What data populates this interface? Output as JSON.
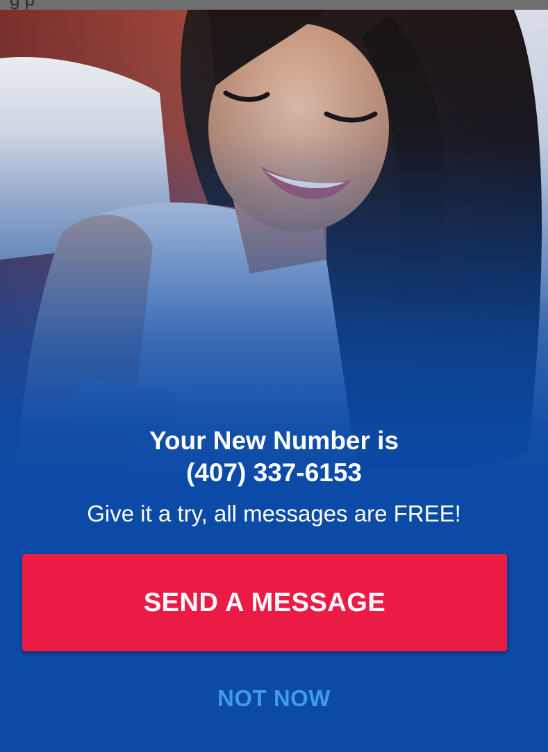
{
  "status_bar": {
    "partial_text": "g p"
  },
  "promo": {
    "headline_line1": "Your New Number is",
    "headline_line2": "(407) 337-6153",
    "subtext": "Give it a try, all messages are FREE!",
    "send_button_label": "SEND A MESSAGE",
    "not_now_label": "NOT NOW"
  },
  "colors": {
    "background_blue": "#0b4aa6",
    "send_button": "#eb1b45",
    "not_now_text": "#3f9be8",
    "headline_text": "#ffffff"
  }
}
